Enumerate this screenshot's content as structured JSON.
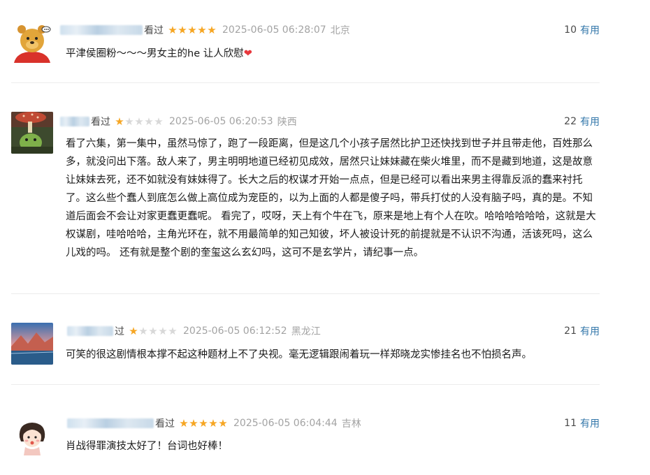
{
  "reviews": [
    {
      "watched": "看过",
      "rating": 5,
      "time": "2025-06-05 06:28:07",
      "location": "北京",
      "votes": "10",
      "useful_label": "有用",
      "content": "平津侯圈粉～～～男女主的he 让人欣慰",
      "emoji": "❤"
    },
    {
      "watched": "看过",
      "rating": 1,
      "time": "2025-06-05 06:20:53",
      "location": "陕西",
      "votes": "22",
      "useful_label": "有用",
      "content": "看了六集，第一集中，虽然马惊了，跑了一段距离，但是这几个小孩子居然比护卫还快找到世子并且带走他，百姓那么多，就没问出下落。敌人来了，男主明明地道已经初见成效，居然只让妹妹藏在柴火堆里，而不是藏到地道，这是故意让妹妹去死，还不如就没有妹妹得了。长大之后的权谋才开始一点点，但是已经可以看出来男主得靠反派的蠢来衬托了。这么些个蠢人到底怎么做上高位成为宠臣的，以为上面的人都是傻子吗，带兵打仗的人没有脑子吗，真的是。不知道后面会不会让对家更蠢更蠢呢。 看完了，哎呀，天上有个牛在飞，原来是地上有个人在吹。哈哈哈哈哈哈，这就是大权谋剧，哇哈哈哈，主角光环在，就不用最简单的知己知彼，坏人被设计死的前提就是不认识不沟通，活该死吗，这么儿戏的吗。 还有就是整个剧的奎玺这么玄幻吗，这可不是玄学片，请纪事一点。"
    },
    {
      "watched": "过",
      "rating": 1,
      "time": "2025-06-05 06:12:52",
      "location": "黑龙江",
      "votes": "21",
      "useful_label": "有用",
      "content": "可笑的很这剧情根本撑不起这种题材上不了央视。毫无逻辑跟闹着玩一样郑晓龙实惨挂名也不怕损名声。"
    },
    {
      "watched": "看过",
      "rating": 5,
      "time": "2025-06-05 06:04:44",
      "location": "吉林",
      "votes": "11",
      "useful_label": "有用",
      "content": "肖战得罪演技太好了！台词也好棒！"
    }
  ]
}
